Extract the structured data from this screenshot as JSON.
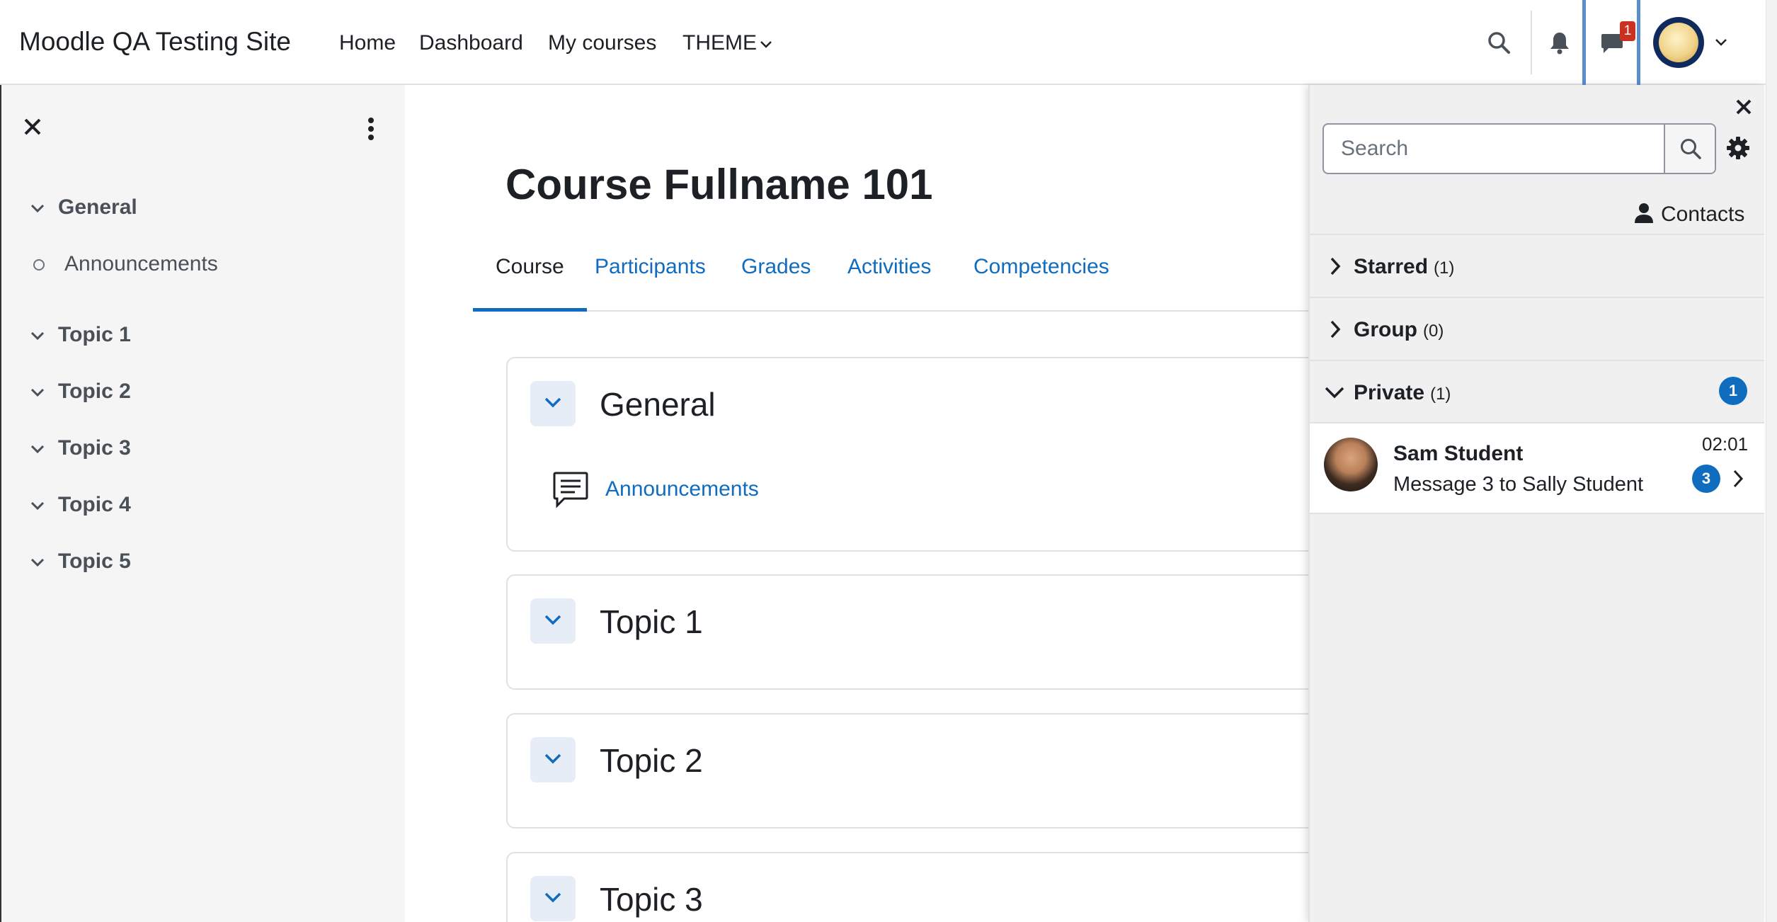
{
  "navbar": {
    "site_name": "Moodle QA Testing Site",
    "links": [
      "Home",
      "Dashboard",
      "My courses",
      "THEME"
    ],
    "message_badge": "1",
    "icons": [
      "search-icon",
      "bell-icon",
      "chat-icon",
      "chevron-down-icon"
    ]
  },
  "course_index": {
    "items": [
      "General",
      "Announcements",
      "Topic 1",
      "Topic 2",
      "Topic 3",
      "Topic 4",
      "Topic 5"
    ]
  },
  "main": {
    "title": "Course Fullname 101",
    "tabs": [
      "Course",
      "Participants",
      "Grades",
      "Activities",
      "Competencies"
    ],
    "active_tab": "Course",
    "sections": [
      {
        "title": "General",
        "activity": "Announcements"
      },
      {
        "title": "Topic 1"
      },
      {
        "title": "Topic 2"
      },
      {
        "title": "Topic 3"
      }
    ]
  },
  "messages": {
    "search_placeholder": "Search",
    "contacts_label": "Contacts",
    "groups": [
      {
        "label": "Starred",
        "count": "(1)"
      },
      {
        "label": "Group",
        "count": "(0)"
      },
      {
        "label": "Private",
        "count": "(1)",
        "badge": "1"
      }
    ],
    "conversation": {
      "name": "Sam Student",
      "message": "Message 3 to Sally Student",
      "time": "02:01",
      "unread": "3"
    }
  },
  "colors": {
    "link": "#0f6cbf",
    "badge_red": "#ca3120",
    "focus_outline": "#5a8ecb"
  }
}
